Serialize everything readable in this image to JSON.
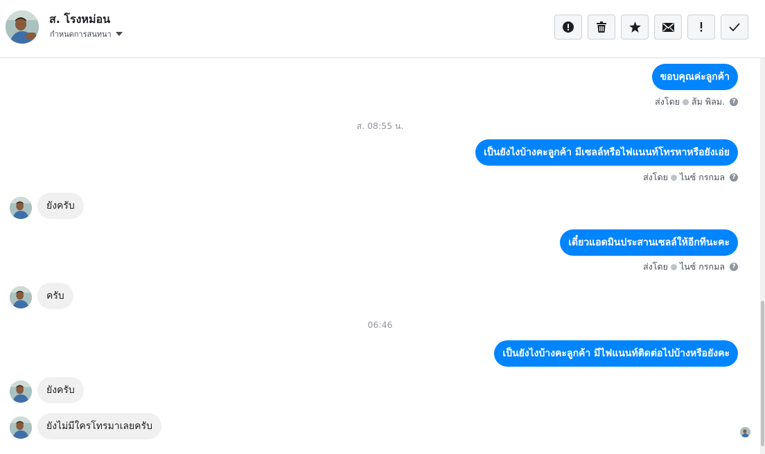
{
  "header": {
    "contact_name": "ส. โรงหม่อน",
    "assign_label": "กำหนดการสนทนา",
    "toolbar_icons": [
      "alert-icon",
      "trash-icon",
      "star-icon",
      "mail-icon",
      "exclamation-icon",
      "check-icon"
    ]
  },
  "conversation": {
    "messages": [
      {
        "direction": "out",
        "text": "ขอบคุณค่ะลูกค้า",
        "meta_prefix": "ส่งโดย",
        "sender": "ส้ม พิลม."
      },
      {
        "type": "time",
        "text": "ส. 08:55 น."
      },
      {
        "direction": "out",
        "text": "เป็นยังไงบ้างคะลูกค้า มีเซลล์หรือไฟแนนท์โทรหาหรือยังเอ่ย",
        "meta_prefix": "ส่งโดย",
        "sender": "ไนซ์ กรกมล"
      },
      {
        "direction": "in",
        "text": "ยังครับ"
      },
      {
        "direction": "out",
        "text": "เดี๋ยวแอดมินประสานเซลล์ให้อีกทีนะคะ",
        "meta_prefix": "ส่งโดย",
        "sender": "ไนซ์ กรกมล"
      },
      {
        "direction": "in",
        "text": "ครับ"
      },
      {
        "type": "time",
        "text": "06:46"
      },
      {
        "direction": "out",
        "text": "เป็นยังไงบ้างคะลูกค้า มีไฟแนนท์ติดต่อไปบ้างหรือยังคะ"
      },
      {
        "direction": "in",
        "text": "ยังครับ"
      },
      {
        "direction": "in",
        "text": "ยังไม่มีใครโทรมาเลยครับ"
      }
    ]
  },
  "colors": {
    "outgoing_bubble": "#0084ff",
    "incoming_bubble": "#f1f0f0",
    "meta_text": "#4b4f56",
    "timestamp_text": "#90949c"
  }
}
